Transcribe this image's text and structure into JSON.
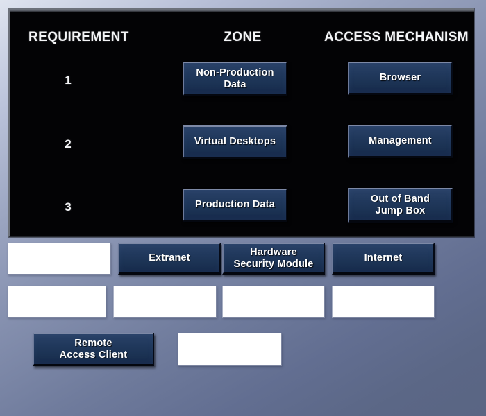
{
  "panel": {
    "headers": {
      "requirement": "REQUIREMENT",
      "zone": "ZONE",
      "access_mechanism": "ACCESS MECHANISM"
    },
    "rows": [
      {
        "number": "1",
        "zone": "Non-Production Data",
        "zone_line1": "Non-Production",
        "zone_line2": "Data",
        "access": "Browser",
        "access_line1": "Browser",
        "access_line2": ""
      },
      {
        "number": "2",
        "zone": "Virtual Desktops",
        "zone_line1": "Virtual Desktops",
        "zone_line2": "",
        "access": "Management",
        "access_line1": "Management",
        "access_line2": ""
      },
      {
        "number": "3",
        "zone": "Production Data",
        "zone_line1": "Production Data",
        "zone_line2": "",
        "access": "Out of Band Jump Box",
        "access_line1": "Out of Band",
        "access_line2": "Jump Box"
      }
    ]
  },
  "lower": {
    "row1": [
      {
        "label": "",
        "type": "blank"
      },
      {
        "label": "Extranet",
        "line1": "Extranet",
        "line2": "",
        "type": "button"
      },
      {
        "label": "Hardware Security Module",
        "line1": "Hardware",
        "line2": "Security Module",
        "type": "button"
      },
      {
        "label": "Internet",
        "line1": "Internet",
        "line2": "",
        "type": "button"
      }
    ],
    "row2": [
      {
        "label": "",
        "type": "blank"
      },
      {
        "label": "",
        "type": "blank"
      },
      {
        "label": "",
        "type": "blank"
      },
      {
        "label": "",
        "type": "blank"
      }
    ],
    "row3": [
      {
        "label": "Remote Access Client",
        "line1": "Remote",
        "line2": "Access Client",
        "type": "button"
      },
      {
        "label": "",
        "type": "blank"
      }
    ]
  },
  "colors": {
    "panel_background": "#030305",
    "button_fill": "#21395d",
    "button_highlight": "#7d89a6",
    "button_text": "#ffffff",
    "page_background_top": "#dfe4ef",
    "page_background_bottom": "#5a6583",
    "blank_box_fill": "#ffffff"
  }
}
